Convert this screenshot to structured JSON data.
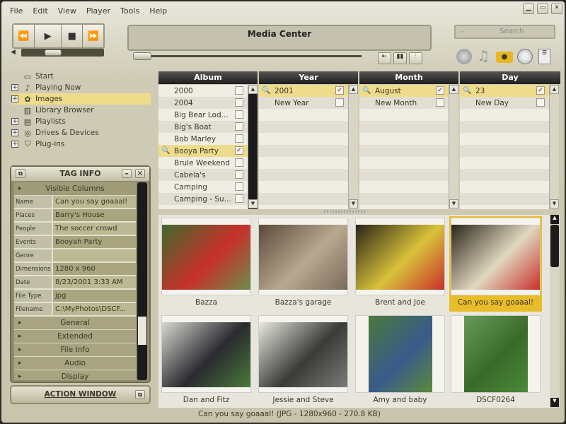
{
  "menu": [
    "File",
    "Edit",
    "View",
    "Player",
    "Tools",
    "Help"
  ],
  "window_controls": {
    "minimize": "minimize-icon",
    "maximize": "maximize-icon",
    "close": "close-icon"
  },
  "transport": {
    "prev": "⏪",
    "play": "▶",
    "stop": "■",
    "next": "⏩"
  },
  "display_title": "Media Center",
  "search_placeholder": "Search",
  "volume_level": 0.35,
  "progress_level": 0.0,
  "tree": [
    {
      "label": "Start",
      "icon": "start-icon",
      "expand": false
    },
    {
      "label": "Playing Now",
      "icon": "playing-now-icon",
      "expand": true
    },
    {
      "label": "Images",
      "icon": "images-icon",
      "expand": true,
      "selected": true
    },
    {
      "label": "Library Browser",
      "icon": "library-icon",
      "expand": false
    },
    {
      "label": "Playlists",
      "icon": "playlists-icon",
      "expand": true
    },
    {
      "label": "Drives & Devices",
      "icon": "drives-icon",
      "expand": true
    },
    {
      "label": "Plug-ins",
      "icon": "plugins-icon",
      "expand": true
    }
  ],
  "columns": [
    {
      "header": "Album",
      "items": [
        {
          "label": "2000"
        },
        {
          "label": "2004"
        },
        {
          "label": "Big Bear Lod..."
        },
        {
          "label": "Big's Boat"
        },
        {
          "label": "Bob Marley"
        },
        {
          "label": "Booya Party",
          "selected": true
        },
        {
          "label": "Brule Weekend"
        },
        {
          "label": "Cabela's"
        },
        {
          "label": "Camping"
        },
        {
          "label": "Camping - Su..."
        }
      ]
    },
    {
      "header": "Year",
      "items": [
        {
          "label": "2001",
          "selected": true
        },
        {
          "label": "New Year"
        }
      ]
    },
    {
      "header": "Month",
      "items": [
        {
          "label": "August",
          "selected": true
        },
        {
          "label": "New Month"
        }
      ]
    },
    {
      "header": "Day",
      "items": [
        {
          "label": "23",
          "selected": true
        },
        {
          "label": "New Day"
        }
      ]
    }
  ],
  "tag_info": {
    "title": "TAG INFO",
    "visible_columns": "Visible Columns",
    "fields": [
      {
        "k": "Name",
        "v": "Can you say goaaal!"
      },
      {
        "k": "Places",
        "v": "Barry's House"
      },
      {
        "k": "People",
        "v": "The soccer crowd"
      },
      {
        "k": "Events",
        "v": "Booyah Party"
      },
      {
        "k": "Genre",
        "v": ""
      },
      {
        "k": "Dimensions",
        "v": "1280 x 960"
      },
      {
        "k": "Date",
        "v": "8/23/2001 3:33 AM"
      },
      {
        "k": "File Type",
        "v": "jpg"
      },
      {
        "k": "Filename",
        "v": "C:\\MyPhotos\\DSCF..."
      }
    ],
    "sections": [
      "General",
      "Extended",
      "File Info",
      "Audio",
      "Display"
    ]
  },
  "action_window": "ACTION WINDOW",
  "thumbnails": [
    {
      "caption": "Bazza",
      "colors": [
        "#3f6a2e",
        "#c8302a",
        "#6b8d4a"
      ]
    },
    {
      "caption": "Bazza's garage",
      "colors": [
        "#5b4a3a",
        "#b8a890",
        "#7a6a5a"
      ]
    },
    {
      "caption": "Brent and Joe",
      "colors": [
        "#2a2418",
        "#d8c23a",
        "#c8302a"
      ]
    },
    {
      "caption": "Can you say goaaal!",
      "colors": [
        "#2a2418",
        "#e0d8c0",
        "#c8302a"
      ],
      "selected": true
    },
    {
      "caption": "Dan and Fitz",
      "colors": [
        "#d8d8d0",
        "#2a2a30",
        "#4a7a3a"
      ]
    },
    {
      "caption": "Jessie and Steve",
      "colors": [
        "#e8e8e0",
        "#3a3a38",
        "#7a7a78"
      ]
    },
    {
      "caption": "Amy and baby",
      "colors": [
        "#4a7a3a",
        "#3a5a8a",
        "#5a8a3a"
      ]
    },
    {
      "caption": "DSCF0264",
      "colors": [
        "#6a9a5a",
        "#3a6a2a",
        "#4a8a3a"
      ]
    }
  ],
  "status": "Can you say goaaal! (JPG - 1280x960 - 270.8 KB)",
  "colors": {
    "selection": "#eedc8c",
    "thumb_selected": "#e9bd2a",
    "header": "#1e1e1e"
  }
}
